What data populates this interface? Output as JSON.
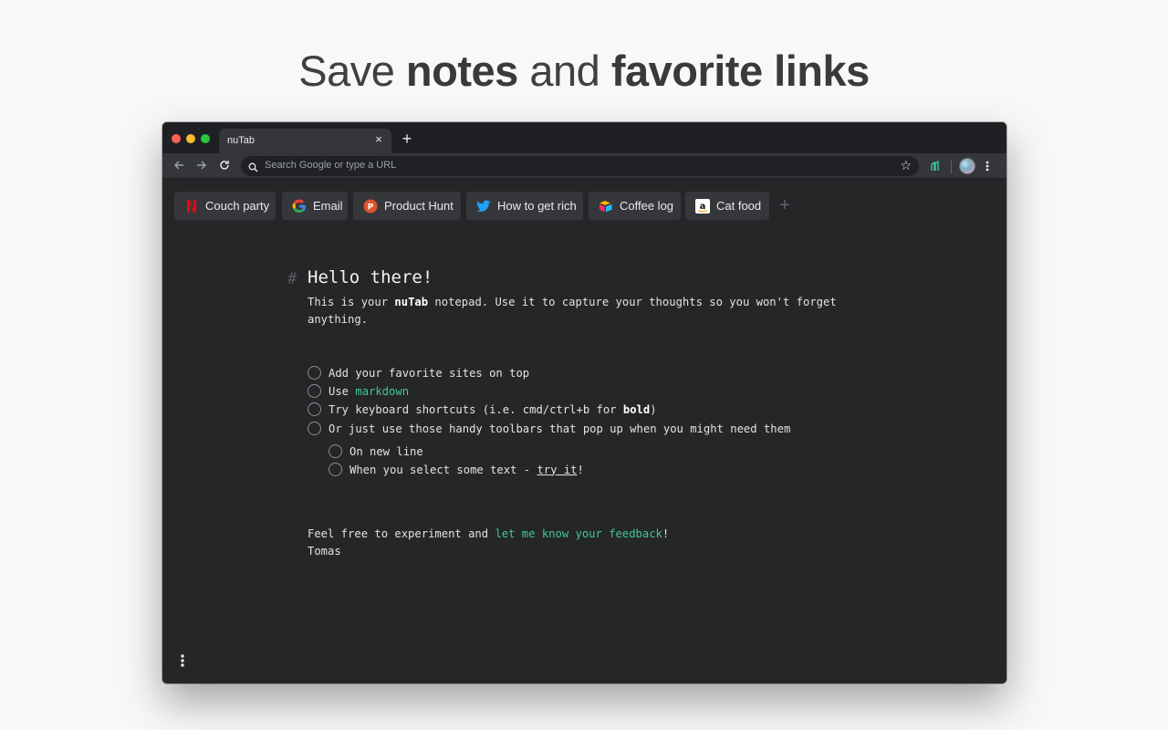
{
  "headline": {
    "part1": "Save ",
    "part2": "notes",
    "part3": " and ",
    "part4": "favorite links"
  },
  "browser": {
    "tab_title": "nuTab",
    "tab_close": "×",
    "new_tab": "+",
    "omnibox_placeholder": "Search Google or type a URL",
    "star": "☆"
  },
  "bookmarks": [
    {
      "label": "Couch party",
      "icon": "netflix-icon"
    },
    {
      "label": "Email",
      "icon": "google-icon"
    },
    {
      "label": "Product Hunt",
      "icon": "producthunt-icon"
    },
    {
      "label": "How to get rich",
      "icon": "twitter-icon"
    },
    {
      "label": "Coffee log",
      "icon": "airtable-icon"
    },
    {
      "label": "Cat food",
      "icon": "amazon-icon"
    }
  ],
  "bookmark_add": "+",
  "note": {
    "hash": "#",
    "title": "Hello there!",
    "intro_pre": "This is your ",
    "intro_bold": "nuTab",
    "intro_post": " notepad. Use it to capture your thoughts so you won't forget anything.",
    "todos": {
      "t1": "Add your favorite sites on top",
      "t2_pre": "Use ",
      "t2_link": "markdown",
      "t3_pre": "Try keyboard shortcuts (i.e. cmd/ctrl+b for ",
      "t3_bold": "bold",
      "t3_post": ")",
      "t4": "Or just use those handy toolbars that pop up when you might need them",
      "t5": "On new line",
      "t6_pre": "When you select some text - ",
      "t6_link": "try it",
      "t6_post": "!"
    },
    "footer_pre": "Feel free to experiment and ",
    "footer_link": "let me know your feedback",
    "footer_post": "!",
    "signature": "Tomas"
  },
  "colors": {
    "accent_link": "#3ec79b",
    "background": "#252628",
    "toolbar": "#35363a"
  }
}
